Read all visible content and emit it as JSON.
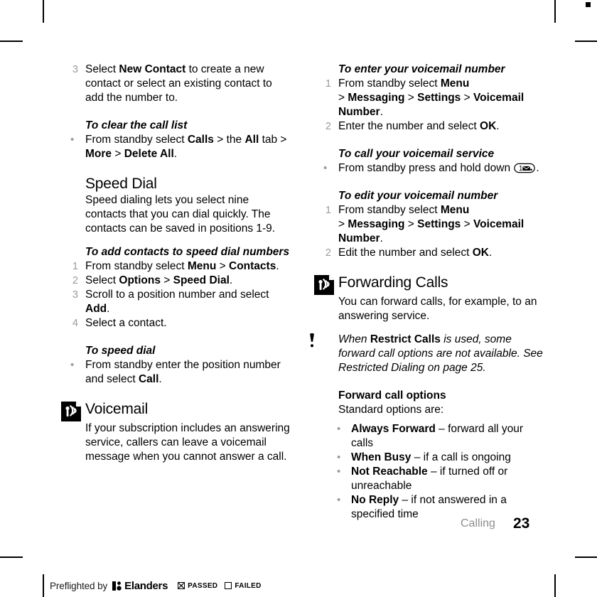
{
  "document": {
    "footer": {
      "section": "Calling",
      "page_number": "23"
    },
    "preflight": {
      "prefix": "Preflighted by",
      "brand": "Elanders",
      "passed_label": "PASSED",
      "failed_label": "FAILED",
      "passed_checked": true,
      "failed_checked": false
    }
  },
  "left_column": {
    "step3": {
      "num": "3",
      "t1": "Select ",
      "b1": "New Contact",
      "t2": " to create a new contact or select an existing contact to add the number to."
    },
    "clear_call_list": {
      "heading": "To clear the call list",
      "bullet": "•",
      "t1": "From standby select ",
      "b1": "Calls",
      "t2": " > the ",
      "b2": "All",
      "t3": " tab > ",
      "b3": "More",
      "t4": " > ",
      "b4": "Delete All",
      "t5": "."
    },
    "speed_dial": {
      "title": "Speed Dial",
      "body": "Speed dialing lets you select nine contacts that you can dial quickly. The contacts can be saved in positions 1-9."
    },
    "add_contacts": {
      "heading": "To add contacts to speed dial numbers",
      "steps": [
        {
          "num": "1",
          "t1": "From standby select ",
          "b1": "Menu",
          "t2": " > ",
          "b2": "Contacts",
          "t3": "."
        },
        {
          "num": "2",
          "t1": "Select ",
          "b1": "Options",
          "t2": " > ",
          "b2": "Speed Dial",
          "t3": "."
        },
        {
          "num": "3",
          "t1": "Scroll to a position number and select ",
          "b1": "Add",
          "t2": "."
        },
        {
          "num": "4",
          "t1": "Select a contact.",
          "b1": "",
          "t2": ""
        }
      ]
    },
    "to_speed_dial": {
      "heading": "To speed dial",
      "bullet": "•",
      "t1": "From standby enter the position number and select ",
      "b1": "Call",
      "t2": "."
    },
    "voicemail": {
      "icon": "voicemail-icon",
      "title": "Voicemail",
      "body": "If your subscription includes an answering service, callers can leave a voicemail message when you cannot answer a call."
    }
  },
  "right_column": {
    "enter_voicemail_number": {
      "heading": "To enter your voicemail number",
      "steps": [
        {
          "num": "1",
          "t1": "From standby select ",
          "b1": "Menu",
          "t2": "",
          "b2": "",
          "t3": "",
          "line2_gt": "> ",
          "b3": "Messaging",
          "t4": " > ",
          "b4": "Settings",
          "t5": " > ",
          "b5": "Voicemail Number",
          "t6": "."
        },
        {
          "num": "2",
          "t1": "Enter the number and select ",
          "b1": "OK",
          "t2": "."
        }
      ]
    },
    "call_voicemail_service": {
      "heading": "To call your voicemail service",
      "bullet": "•",
      "t1": "From standby press and hold down ",
      "key": "key-1-voicemail",
      "key_digit": "1",
      "t2": "."
    },
    "edit_voicemail_number": {
      "heading": "To edit your voicemail number",
      "steps": [
        {
          "num": "1",
          "t1": "From standby select ",
          "b1": "Menu",
          "line2_gt": "> ",
          "b3": "Messaging",
          "t4": " > ",
          "b4": "Settings",
          "t5": " > ",
          "b5": "Voicemail Number",
          "t6": "."
        },
        {
          "num": "2",
          "t1": "Edit the number and select ",
          "b1": "OK",
          "t2": "."
        }
      ]
    },
    "forwarding_calls": {
      "icon": "forwarding-calls-icon",
      "title": "Forwarding Calls",
      "body": "You can forward calls, for example, to an answering service."
    },
    "note": {
      "icon": "note-exclamation-icon",
      "t1": "When ",
      "b1": "Restrict Calls",
      "t2": " is used, some forward call options are not available. See Restricted Dialing on page 25."
    },
    "forward_call_options": {
      "heading": "Forward call options",
      "intro": "Standard options are:",
      "bullet": "•",
      "options": [
        {
          "name": "Always Forward",
          "dash": " – ",
          "desc": "forward all your calls"
        },
        {
          "name": "When Busy",
          "dash": " – ",
          "desc": "if a call is ongoing"
        },
        {
          "name": "Not Reachable",
          "dash": " – ",
          "desc": "if turned off or unreachable"
        },
        {
          "name": "No Reply",
          "dash": " – ",
          "desc": "if not answered in a specified time"
        }
      ]
    }
  }
}
